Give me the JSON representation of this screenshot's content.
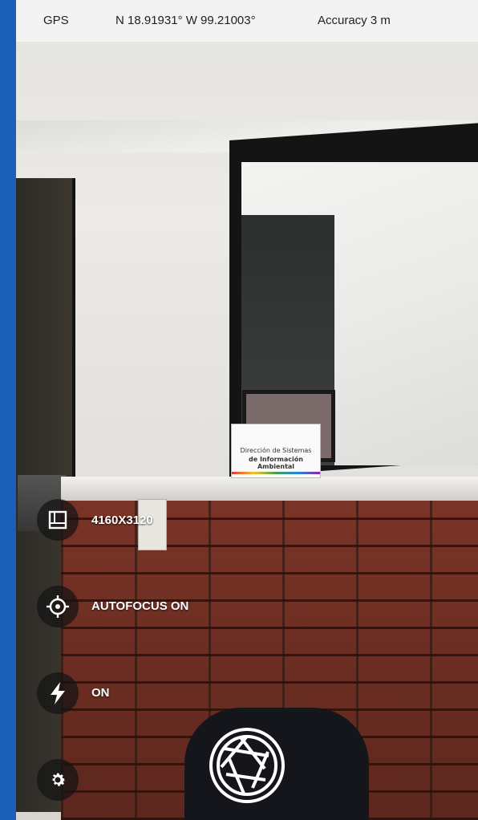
{
  "status_bar": {
    "gps_label": "GPS",
    "coordinates": "N 18.91931° W 99.21003°",
    "accuracy": "Accuracy 3 m"
  },
  "scene": {
    "sign_line1": "Dirección de Sistemas",
    "sign_line2": "de Información Ambiental"
  },
  "controls": {
    "resolution": {
      "icon": "image-size-icon",
      "label": "4160X3120"
    },
    "autofocus": {
      "icon": "crosshair-icon",
      "label": "AUTOFOCUS ON"
    },
    "flash": {
      "icon": "flash-icon",
      "label": "ON"
    },
    "settings": {
      "icon": "gear-icon"
    },
    "shutter": {
      "icon": "shutter-icon"
    }
  },
  "colors": {
    "frame_blue": "#1b5fb8",
    "overlay_text": "#ffffff",
    "status_bar_bg": "#f3f3f3"
  }
}
